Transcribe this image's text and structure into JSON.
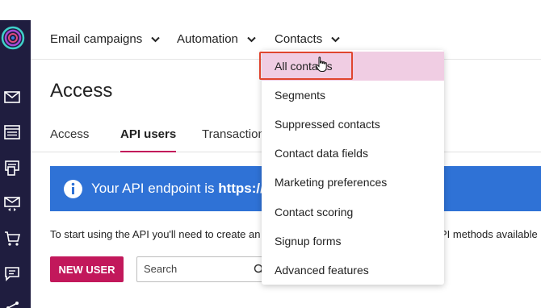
{
  "topnav": {
    "items": [
      {
        "label": "Email campaigns"
      },
      {
        "label": "Automation"
      },
      {
        "label": "Contacts"
      }
    ]
  },
  "page": {
    "title": "Access",
    "tabs": [
      {
        "label": "Access",
        "active": false
      },
      {
        "label": "API users",
        "active": true
      },
      {
        "label": "Transaction",
        "active": false
      }
    ]
  },
  "banner": {
    "text": "Your API endpoint is ",
    "endpoint": "https://r1"
  },
  "help": {
    "text_left": "To start using the API you'll need to create an",
    "text_right": "PI methods available"
  },
  "actions": {
    "new_user_label": "NEW USER",
    "search_placeholder": "Search"
  },
  "dropdown": {
    "items": [
      {
        "label": "All contacts",
        "highlighted": true
      },
      {
        "label": "Segments"
      },
      {
        "label": "Suppressed contacts"
      },
      {
        "label": "Contact data fields"
      },
      {
        "label": "Marketing preferences"
      },
      {
        "label": "Contact scoring"
      },
      {
        "label": "Signup forms"
      },
      {
        "label": "Advanced features"
      }
    ]
  },
  "sidebar": {
    "icons": [
      "logo-icon",
      "envelope-icon",
      "newsletter-icon",
      "sms-icon",
      "email-automation-icon",
      "cart-icon",
      "chat-icon",
      "share-icon"
    ]
  },
  "colors": {
    "sidebar_bg": "#1f1d3f",
    "accent": "#c2185b",
    "banner_bg": "#2f72d6",
    "dropdown_highlight": "#f0cde3",
    "annotation_box": "#e0452f"
  }
}
